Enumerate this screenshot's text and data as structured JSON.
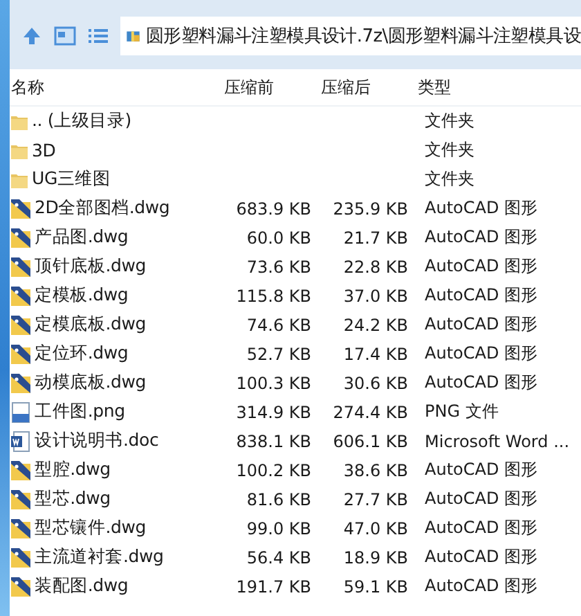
{
  "address": "圆形塑料漏斗注塑模具设计.7z\\圆形塑料漏斗注塑模具设",
  "columns": [
    "名称",
    "压缩前",
    "压缩后",
    "类型"
  ],
  "rows": [
    {
      "kind": "folder",
      "name": ".. (上级目录)",
      "type": "文件夹"
    },
    {
      "kind": "folder",
      "name": "3D",
      "type": "文件夹"
    },
    {
      "kind": "folder",
      "name": "UG三维图",
      "type": "文件夹"
    },
    {
      "kind": "dwg",
      "name": "2D全部图档.dwg",
      "size": "683.9 KB",
      "packed": "235.9 KB",
      "type": "AutoCAD 图形"
    },
    {
      "kind": "dwg",
      "name": "产品图.dwg",
      "size": "60.0 KB",
      "packed": "21.7 KB",
      "type": "AutoCAD 图形"
    },
    {
      "kind": "dwg",
      "name": "顶针底板.dwg",
      "size": "73.6 KB",
      "packed": "22.8 KB",
      "type": "AutoCAD 图形"
    },
    {
      "kind": "dwg",
      "name": "定模板.dwg",
      "size": "115.8 KB",
      "packed": "37.0 KB",
      "type": "AutoCAD 图形"
    },
    {
      "kind": "dwg",
      "name": "定模底板.dwg",
      "size": "74.6 KB",
      "packed": "24.2 KB",
      "type": "AutoCAD 图形"
    },
    {
      "kind": "dwg",
      "name": "定位环.dwg",
      "size": "52.7 KB",
      "packed": "17.4 KB",
      "type": "AutoCAD 图形"
    },
    {
      "kind": "dwg",
      "name": "动模底板.dwg",
      "size": "100.3 KB",
      "packed": "30.6 KB",
      "type": "AutoCAD 图形"
    },
    {
      "kind": "png",
      "name": "工件图.png",
      "size": "314.9 KB",
      "packed": "274.4 KB",
      "type": "PNG 文件"
    },
    {
      "kind": "doc",
      "name": "设计说明书.doc",
      "size": "838.1 KB",
      "packed": "606.1 KB",
      "type": "Microsoft Word ..."
    },
    {
      "kind": "dwg",
      "name": "型腔.dwg",
      "size": "100.2 KB",
      "packed": "38.6 KB",
      "type": "AutoCAD 图形"
    },
    {
      "kind": "dwg",
      "name": "型芯.dwg",
      "size": "81.6 KB",
      "packed": "27.7 KB",
      "type": "AutoCAD 图形"
    },
    {
      "kind": "dwg",
      "name": "型芯镶件.dwg",
      "size": "99.0 KB",
      "packed": "47.0 KB",
      "type": "AutoCAD 图形"
    },
    {
      "kind": "dwg",
      "name": "主流道衬套.dwg",
      "size": "56.4 KB",
      "packed": "18.9 KB",
      "type": "AutoCAD 图形"
    },
    {
      "kind": "dwg",
      "name": "装配图.dwg",
      "size": "191.7 KB",
      "packed": "59.1 KB",
      "type": "AutoCAD 图形"
    }
  ]
}
